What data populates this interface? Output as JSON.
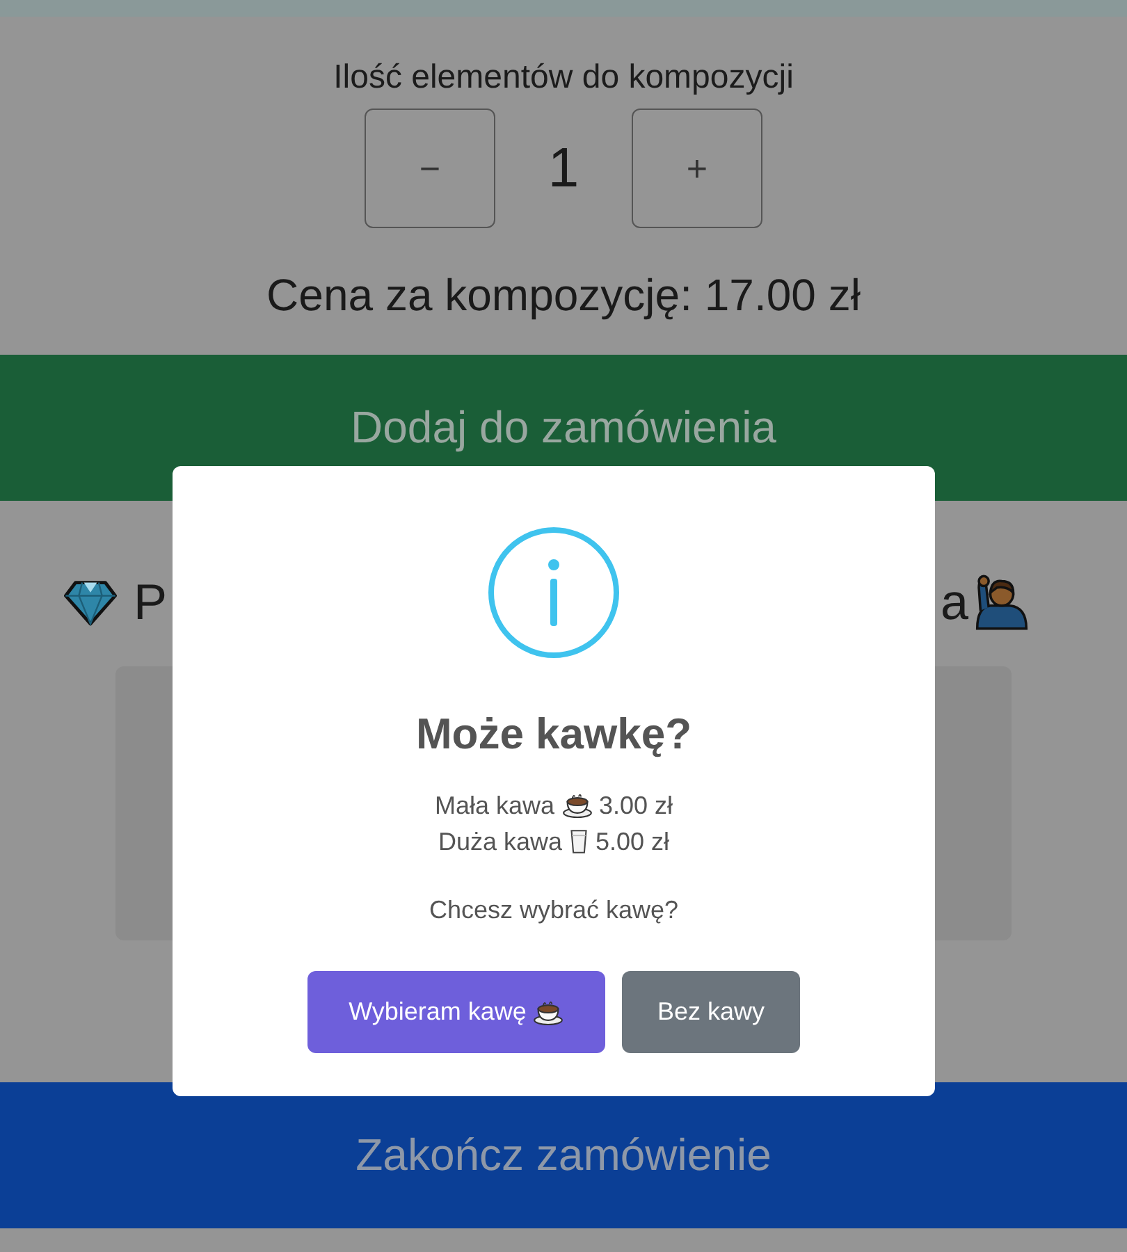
{
  "page": {
    "quantity_label": "Ilość elementów do kompozycji",
    "decrement": "−",
    "quantity": "1",
    "increment": "+",
    "price": "Cena za kompozycję: 17.00 zł",
    "add_button": "Dodaj do zamówienia",
    "section_heading_start": "P",
    "section_heading_end": "a",
    "finish_button": "Zakończ zamówienie"
  },
  "dialog": {
    "title": "Może kawkę?",
    "options": [
      {
        "name": "Mała kawa",
        "kind": "cup",
        "price": "3.00 zł"
      },
      {
        "name": "Duża kawa",
        "kind": "glass",
        "price": "5.00 zł"
      }
    ],
    "question": "Chcesz wybrać kawę?",
    "buttons": [
      {
        "label": "Wybieram kawę",
        "kind": "confirm"
      },
      {
        "label": "Bez kawy",
        "kind": "cancel"
      }
    ]
  }
}
